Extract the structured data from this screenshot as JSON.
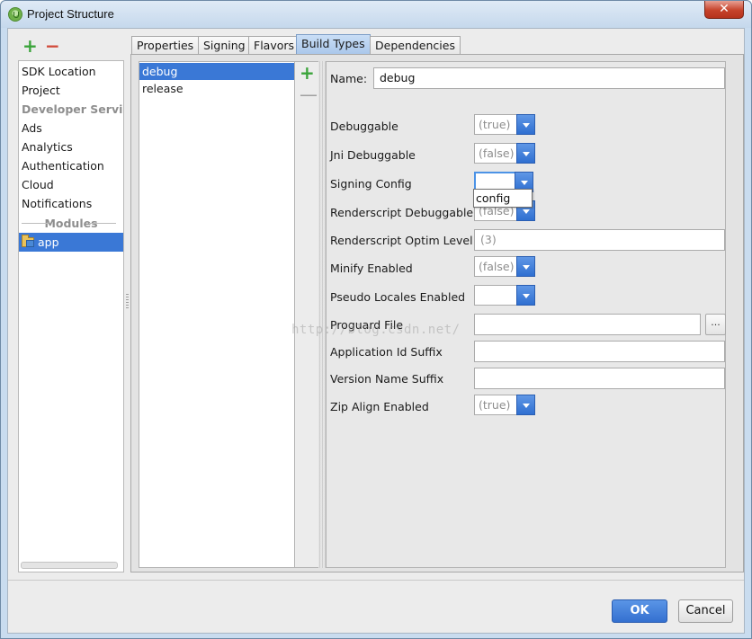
{
  "window": {
    "title": "Project Structure",
    "close_label": "✕",
    "app_icon": "android-studio-icon"
  },
  "toolbar": {
    "add_label": "+",
    "remove_label": "−"
  },
  "nav": {
    "items": [
      {
        "label": "SDK Location"
      },
      {
        "label": "Project"
      },
      {
        "label": "Developer Services"
      },
      {
        "label": "Ads"
      },
      {
        "label": "Analytics"
      },
      {
        "label": "Authentication"
      },
      {
        "label": "Cloud"
      },
      {
        "label": "Notifications"
      }
    ],
    "modules_label": "Modules",
    "modules": [
      {
        "label": "app",
        "icon": "module-folder-icon"
      }
    ]
  },
  "tabs": [
    {
      "label": "Properties"
    },
    {
      "label": "Signing"
    },
    {
      "label": "Flavors"
    },
    {
      "label": "Build Types"
    },
    {
      "label": "Dependencies"
    }
  ],
  "build_types": {
    "items": [
      {
        "label": "debug"
      },
      {
        "label": "release"
      }
    ],
    "add_label": "+",
    "remove_label": "—"
  },
  "form": {
    "name_label": "Name:",
    "name_value": "debug",
    "debuggable_label": "Debuggable",
    "debuggable_value": "(true)",
    "jni_label": "Jni Debuggable",
    "jni_value": "(false)",
    "signing_label": "Signing Config",
    "signing_value": "",
    "signing_popup_option": "config",
    "rs_debuggable_label": "Renderscript Debuggable",
    "rs_debuggable_value": "(false)",
    "rs_optim_label": "Renderscript Optim Level",
    "rs_optim_value": "(3)",
    "minify_label": "Minify Enabled",
    "minify_value": "(false)",
    "pseudo_label": "Pseudo Locales Enabled",
    "pseudo_value": "",
    "proguard_label": "Proguard File",
    "proguard_value": "",
    "browse_label": "...",
    "app_id_suffix_label": "Application Id Suffix",
    "app_id_suffix_value": "",
    "version_suffix_label": "Version Name Suffix",
    "version_suffix_value": "",
    "zip_label": "Zip Align Enabled",
    "zip_value": "(true)"
  },
  "watermark": "http://blog.csdn.net/",
  "buttons": {
    "ok": "OK",
    "cancel": "Cancel"
  },
  "colors": {
    "selection": "#3a78d6",
    "active_tab": "#a9c6ea",
    "add_green": "#3aa43a",
    "remove_red": "#d14b3b",
    "ok_blue": "#3470d0"
  }
}
